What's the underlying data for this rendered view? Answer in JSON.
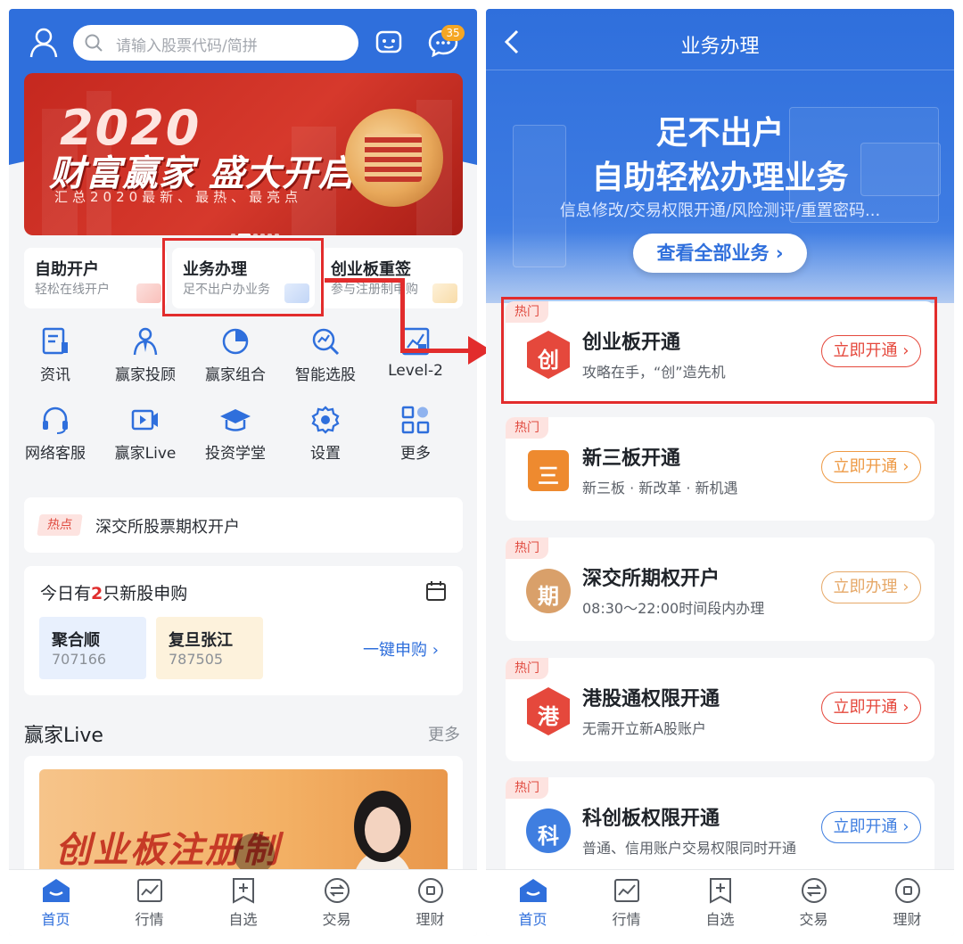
{
  "left": {
    "search_placeholder": "请输入股票代码/简拼",
    "message_badge": "35",
    "banner": {
      "year": "2020",
      "headline": "财富赢家 盛大开启",
      "subline": "汇总2020最新、最热、最亮点"
    },
    "quick": [
      {
        "title": "自助开户",
        "subtitle": "轻松在线开户"
      },
      {
        "title": "业务办理",
        "subtitle": "足不出户办业务"
      },
      {
        "title": "创业板重签",
        "subtitle": "参与注册制申购"
      }
    ],
    "grid": [
      {
        "label": "资讯",
        "icon": "news-icon"
      },
      {
        "label": "赢家投顾",
        "icon": "advisor-icon"
      },
      {
        "label": "赢家组合",
        "icon": "portfolio-pie-icon"
      },
      {
        "label": "智能选股",
        "icon": "smart-pick-icon"
      },
      {
        "label": "Level-2",
        "icon": "level2-icon"
      },
      {
        "label": "网络客服",
        "icon": "headset-icon"
      },
      {
        "label": "赢家Live",
        "icon": "video-icon"
      },
      {
        "label": "投资学堂",
        "icon": "graduation-cap-icon"
      },
      {
        "label": "设置",
        "icon": "gear-icon"
      },
      {
        "label": "更多",
        "icon": "grid-more-icon"
      }
    ],
    "hot": {
      "tag": "热点",
      "text": "深交所股票期权开户"
    },
    "ipo": {
      "title_pre": "今日有",
      "count": "2",
      "title_post": "只新股申购",
      "stocks": [
        {
          "name": "聚合顺",
          "code": "707166"
        },
        {
          "name": "复旦张江",
          "code": "787505"
        }
      ],
      "action": "一键申购 ›"
    },
    "live": {
      "title": "赢家Live",
      "more": "更多",
      "card_text": "创业板注册制"
    },
    "tabs": [
      {
        "label": "首页",
        "icon": "home-icon",
        "active": true
      },
      {
        "label": "行情",
        "icon": "market-chart-icon",
        "active": false
      },
      {
        "label": "自选",
        "icon": "watchlist-add-icon",
        "active": false
      },
      {
        "label": "交易",
        "icon": "trade-exchange-icon",
        "active": false
      },
      {
        "label": "理财",
        "icon": "wealth-icon",
        "active": false
      }
    ]
  },
  "right": {
    "title": "业务办理",
    "hero_line1": "足不出户",
    "hero_line2": "自助轻松办理业务",
    "hero_line3": "信息修改/交易权限开通/风险测评/重置密码...",
    "view_all": "查看全部业务 ›",
    "services": [
      {
        "tag": "热门",
        "glyph": "创",
        "title": "创业板开通",
        "subtitle": "攻略在手，“创”造先机",
        "button": "立即开通 ›",
        "color": "#e5483c",
        "btn_color": "#e5483c"
      },
      {
        "tag": "热门",
        "glyph": "三",
        "title": "新三板开通",
        "subtitle": "新三板 · 新改革 · 新机遇",
        "button": "立即开通 ›",
        "color": "#ee8a2f",
        "btn_color": "#ee9a45"
      },
      {
        "tag": "热门",
        "glyph": "期",
        "title": "深交所期权开户",
        "subtitle": "08:30～22:00时间段内办理",
        "button": "立即办理 ›",
        "color": "#d9a06a",
        "btn_color": "#e6a868"
      },
      {
        "tag": "热门",
        "glyph": "港",
        "title": "港股通权限开通",
        "subtitle": "无需开立新A股账户",
        "button": "立即开通 ›",
        "color": "#e5483c",
        "btn_color": "#e5483c"
      },
      {
        "tag": "热门",
        "glyph": "科",
        "title": "科创板权限开通",
        "subtitle": "普通、信用账户交易权限同时开通",
        "button": "立即开通 ›",
        "color": "#3f7ee0",
        "btn_color": "#3f7ee0"
      }
    ],
    "tabs": [
      {
        "label": "首页",
        "icon": "home-icon",
        "active": true
      },
      {
        "label": "行情",
        "icon": "market-chart-icon",
        "active": false
      },
      {
        "label": "自选",
        "icon": "watchlist-add-icon",
        "active": false
      },
      {
        "label": "交易",
        "icon": "trade-exchange-icon",
        "active": false
      },
      {
        "label": "理财",
        "icon": "wealth-icon",
        "active": false
      }
    ]
  },
  "colors": {
    "brand_blue": "#2f6fdc",
    "highlight_red": "#e22c2c",
    "hot_red": "#e04b40"
  }
}
